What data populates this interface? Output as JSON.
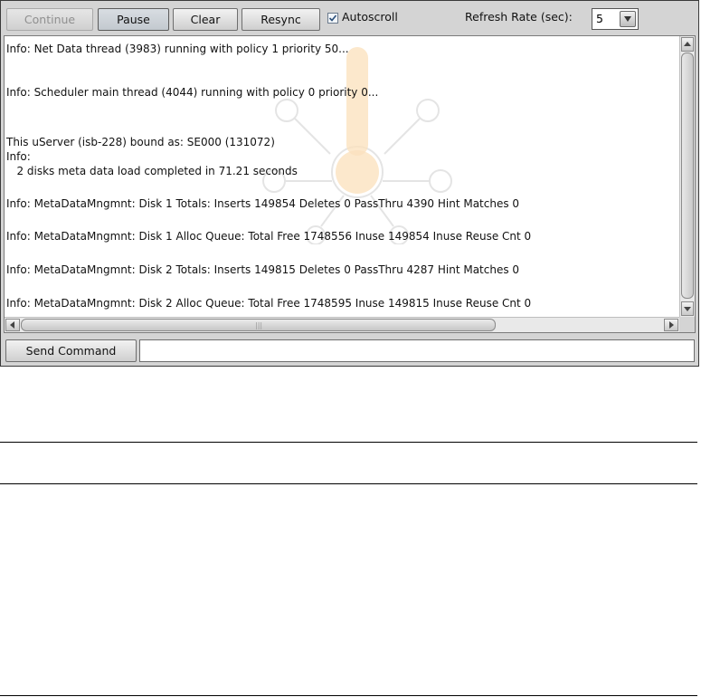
{
  "toolbar": {
    "continue_label": "Continue",
    "pause_label": "Pause",
    "clear_label": "Clear",
    "resync_label": "Resync",
    "autoscroll_label": "Autoscroll",
    "autoscroll_checked": true,
    "refresh_rate_label": "Refresh Rate (sec):",
    "refresh_rate_value": "5"
  },
  "log": {
    "lines": [
      "Info: Net Data thread (3983) running with policy 1 priority 50...",
      "Info: Scheduler main thread (4044) running with policy 0 priority 0...",
      "This uServer (isb-228) bound as: SE000 (131072)",
      "Info:",
      "   2 disks meta data load completed in 71.21 seconds",
      "Info: MetaDataMngmnt: Disk 1 Totals: Inserts 149854 Deletes 0 PassThru 4390 Hint Matches 0",
      "Info: MetaDataMngmnt: Disk 1 Alloc Queue: Total Free 1748556 Inuse 149854 Inuse Reuse Cnt 0",
      "Info: MetaDataMngmnt: Disk 2 Totals: Inserts 149815 Deletes 0 PassThru 4287 Hint Matches 0",
      "Info: MetaDataMngmnt: Disk 2 Alloc Queue: Total Free 1748595 Inuse 149815 Inuse Reuse Cnt 0"
    ]
  },
  "command": {
    "send_label": "Send Command",
    "input_value": ""
  },
  "colors": {
    "watermark_accent": "#f7c98a",
    "watermark_outline": "#cfcfcf"
  }
}
